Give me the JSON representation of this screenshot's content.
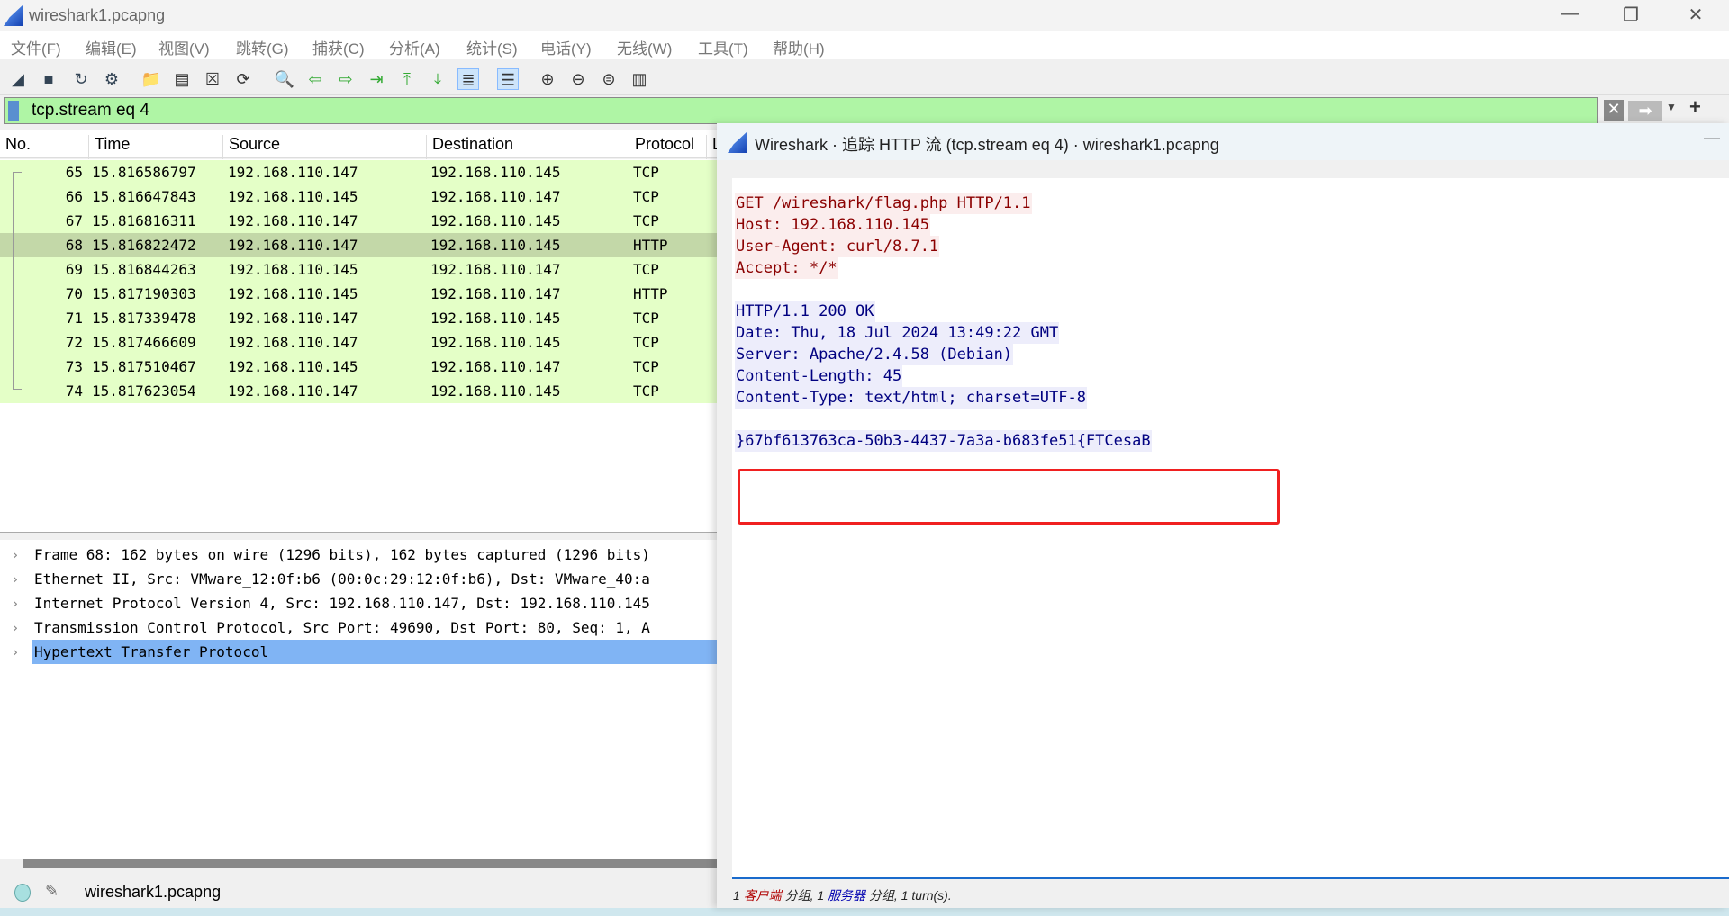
{
  "window": {
    "title": "wireshark1.pcapng"
  },
  "menu": [
    "文件(F)",
    "编辑(E)",
    "视图(V)",
    "跳转(G)",
    "捕获(C)",
    "分析(A)",
    "统计(S)",
    "电话(Y)",
    "无线(W)",
    "工具(T)",
    "帮助(H)"
  ],
  "toolbar": [
    "shark-fin-start",
    "stop",
    "restart",
    "options",
    "open",
    "save",
    "close",
    "reload",
    "find",
    "back",
    "forward",
    "goto",
    "first",
    "last",
    "autoscroll",
    "colorize",
    "zoom-in",
    "zoom-out",
    "zoom-normal",
    "resize-columns"
  ],
  "filter": {
    "value": "tcp.stream eq 4"
  },
  "packet_list": {
    "columns": [
      "No.",
      "Time",
      "Source",
      "Destination",
      "Protocol",
      "L"
    ],
    "rows": [
      {
        "no": "65",
        "time": "15.816586797",
        "src": "192.168.110.147",
        "dst": "192.168.110.145",
        "proto": "TCP"
      },
      {
        "no": "66",
        "time": "15.816647843",
        "src": "192.168.110.145",
        "dst": "192.168.110.147",
        "proto": "TCP"
      },
      {
        "no": "67",
        "time": "15.816816311",
        "src": "192.168.110.147",
        "dst": "192.168.110.145",
        "proto": "TCP"
      },
      {
        "no": "68",
        "time": "15.816822472",
        "src": "192.168.110.147",
        "dst": "192.168.110.145",
        "proto": "HTTP",
        "selected": true
      },
      {
        "no": "69",
        "time": "15.816844263",
        "src": "192.168.110.145",
        "dst": "192.168.110.147",
        "proto": "TCP"
      },
      {
        "no": "70",
        "time": "15.817190303",
        "src": "192.168.110.145",
        "dst": "192.168.110.147",
        "proto": "HTTP"
      },
      {
        "no": "71",
        "time": "15.817339478",
        "src": "192.168.110.147",
        "dst": "192.168.110.145",
        "proto": "TCP"
      },
      {
        "no": "72",
        "time": "15.817466609",
        "src": "192.168.110.147",
        "dst": "192.168.110.145",
        "proto": "TCP"
      },
      {
        "no": "73",
        "time": "15.817510467",
        "src": "192.168.110.145",
        "dst": "192.168.110.147",
        "proto": "TCP"
      },
      {
        "no": "74",
        "time": "15.817623054",
        "src": "192.168.110.147",
        "dst": "192.168.110.145",
        "proto": "TCP"
      }
    ]
  },
  "details": [
    "Frame 68: 162 bytes on wire (1296 bits), 162 bytes captured (1296 bits)",
    "Ethernet II, Src: VMware_12:0f:b6 (00:0c:29:12:0f:b6), Dst: VMware_40:a",
    "Internet Protocol Version 4, Src: 192.168.110.147, Dst: 192.168.110.145",
    "Transmission Control Protocol, Src Port: 49690, Dst Port: 80, Seq: 1, A",
    "Hypertext Transfer Protocol"
  ],
  "status": {
    "file": "wireshark1.pcapng"
  },
  "dialog": {
    "title": "Wireshark · 追踪 HTTP 流 (tcp.stream eq 4) · wireshark1.pcapng",
    "client_lines": [
      "GET /wireshark/flag.php HTTP/1.1",
      "Host: 192.168.110.145",
      "User-Agent: curl/8.7.1",
      "Accept: */*"
    ],
    "server_lines": [
      "HTTP/1.1 200 OK",
      "Date: Thu, 18 Jul 2024 13:49:22 GMT",
      "Server: Apache/2.4.58 (Debian)",
      "Content-Length: 45",
      "Content-Type: text/html; charset=UTF-8"
    ],
    "body": "}67bf613763ca-50b3-4437-7a3a-b683fe51{FTCesaB",
    "footer": {
      "n1": "1 ",
      "client": "客户端",
      "s1": " 分组, 1 ",
      "server": "服务器",
      "s2": " 分组, 1 turn(s)."
    },
    "client_color": "#8b0000",
    "server_color": "#000080",
    "highlight_color": "#f02020"
  }
}
